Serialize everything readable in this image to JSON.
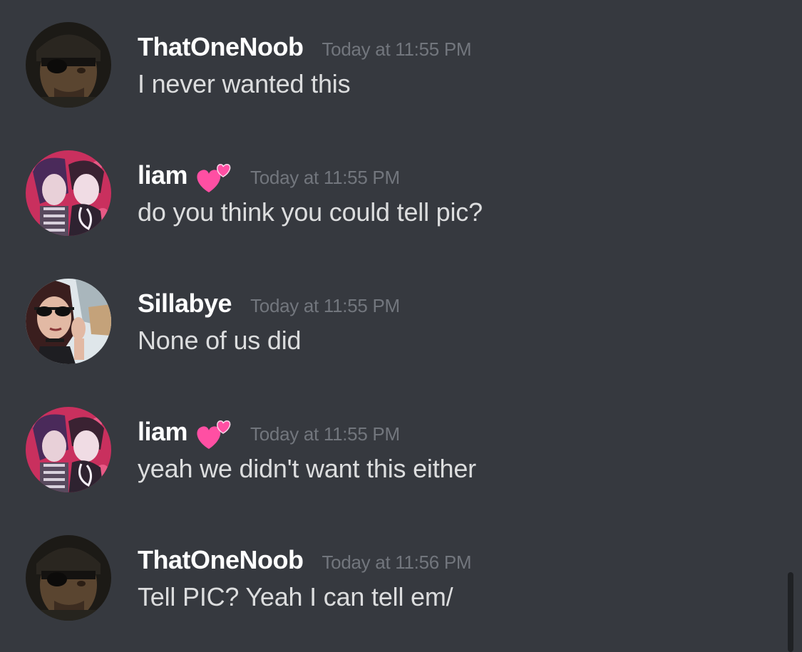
{
  "messages": [
    {
      "username": "ThatOneNoob",
      "timestamp": "Today at 11:55 PM",
      "text": "I never wanted this",
      "avatar": "eyepatch-soldier-avatar",
      "has_heart": false
    },
    {
      "username": "liam",
      "timestamp": "Today at 11:55 PM",
      "text": "do you think you could tell pic?",
      "avatar": "drawn-couple-avatar",
      "has_heart": true
    },
    {
      "username": "Sillabye",
      "timestamp": "Today at 11:55 PM",
      "text": "None of us did",
      "avatar": "sunglasses-girl-avatar",
      "has_heart": false
    },
    {
      "username": "liam",
      "timestamp": "Today at 11:55 PM",
      "text": "yeah we didn't want this either",
      "avatar": "drawn-couple-avatar",
      "has_heart": true
    },
    {
      "username": "ThatOneNoob",
      "timestamp": "Today at 11:56 PM",
      "text": "Tell PIC? Yeah I can tell em/",
      "avatar": "eyepatch-soldier-avatar",
      "has_heart": false
    }
  ],
  "colors": {
    "background": "#36393f",
    "username": "#ffffff",
    "timestamp": "#72767d",
    "message_text": "#dcddde",
    "heart": "#ff4fa3"
  }
}
